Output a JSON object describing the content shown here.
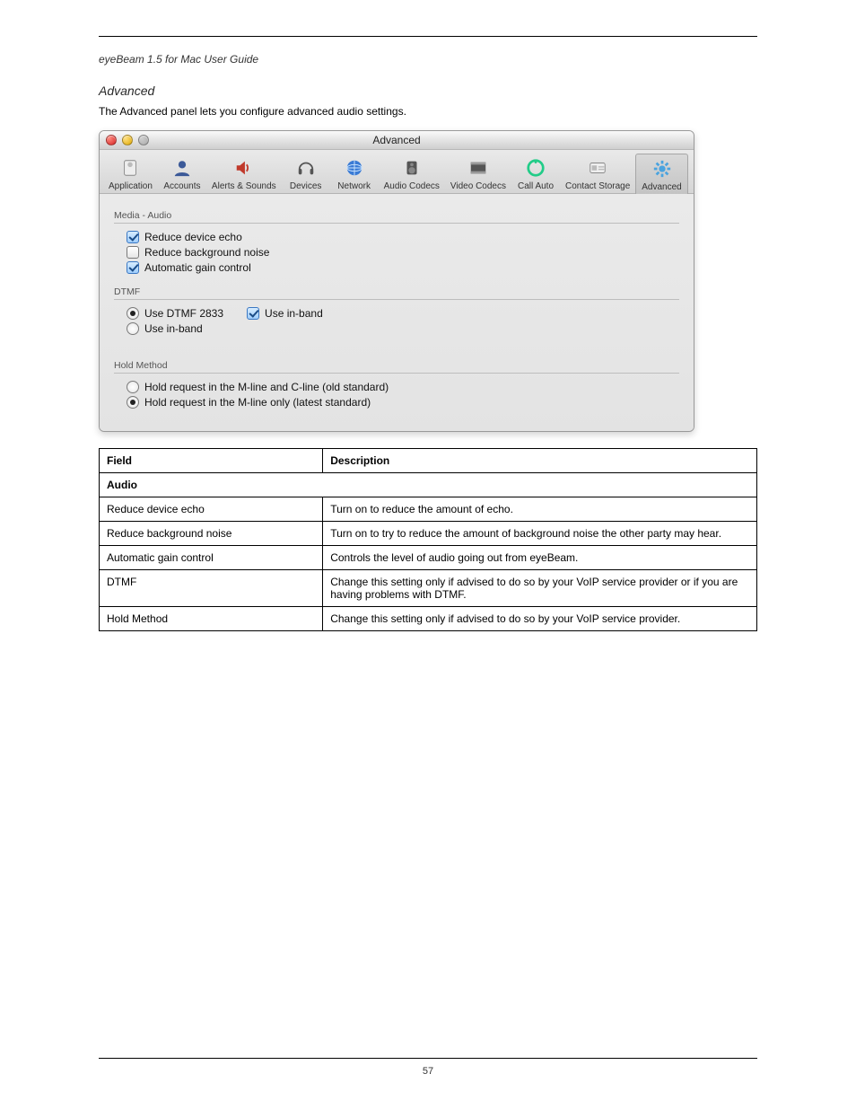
{
  "doc": {
    "header_left": "eyeBeam 1.5 for Mac User Guide",
    "header_right": "",
    "section_title": "Advanced",
    "intro": "The Advanced panel lets you configure advanced audio settings.",
    "footer": "57"
  },
  "window": {
    "title": "Advanced",
    "toolbar": [
      {
        "label": "Application",
        "icon": "app-icon"
      },
      {
        "label": "Accounts",
        "icon": "person-icon"
      },
      {
        "label": "Alerts & Sounds",
        "icon": "speaker-icon"
      },
      {
        "label": "Devices",
        "icon": "headphones-icon"
      },
      {
        "label": "Network",
        "icon": "globe-icon"
      },
      {
        "label": "Audio Codecs",
        "icon": "speaker2-icon"
      },
      {
        "label": "Video Codecs",
        "icon": "film-icon"
      },
      {
        "label": "Call Auto",
        "icon": "dial-icon"
      },
      {
        "label": "Contact Storage",
        "icon": "card-icon"
      },
      {
        "label": "Advanced",
        "icon": "gear-icon",
        "selected": true
      }
    ],
    "groups": {
      "media_audio": {
        "label": "Media - Audio",
        "reduce_echo": {
          "label": "Reduce device echo",
          "checked": true
        },
        "reduce_noise": {
          "label": "Reduce background noise",
          "checked": false
        },
        "agc": {
          "label": "Automatic gain control",
          "checked": true
        }
      },
      "dtmf": {
        "label": "DTMF",
        "use_2833": {
          "label": "Use DTMF 2833",
          "selected": true
        },
        "use_inband_cb": {
          "label": "Use in-band",
          "checked": true
        },
        "use_inband_radio": {
          "label": "Use in-band",
          "selected": false
        }
      },
      "hold": {
        "label": "Hold Method",
        "old": {
          "label": "Hold request in the M-line and C-line (old standard)",
          "selected": false
        },
        "new": {
          "label": "Hold request in the M-line only (latest standard)",
          "selected": true
        }
      }
    }
  },
  "field_table": {
    "columns": [
      "Field",
      "Description"
    ],
    "rows": [
      {
        "section": "Audio"
      },
      {
        "field": "Reduce device echo",
        "desc": "Turn on to reduce the amount of echo."
      },
      {
        "field": "Reduce background noise",
        "desc": "Turn on to try to reduce the amount of background noise the other party may hear."
      },
      {
        "field": "Automatic gain control",
        "desc": "Controls the level of audio going out from eyeBeam."
      },
      {
        "field": "DTMF",
        "desc": "Change this setting only if advised to do so by your VoIP service provider or if you are having problems with DTMF."
      },
      {
        "field": "Hold Method",
        "desc": "Change this setting only if advised to do so by your VoIP service provider."
      }
    ]
  }
}
